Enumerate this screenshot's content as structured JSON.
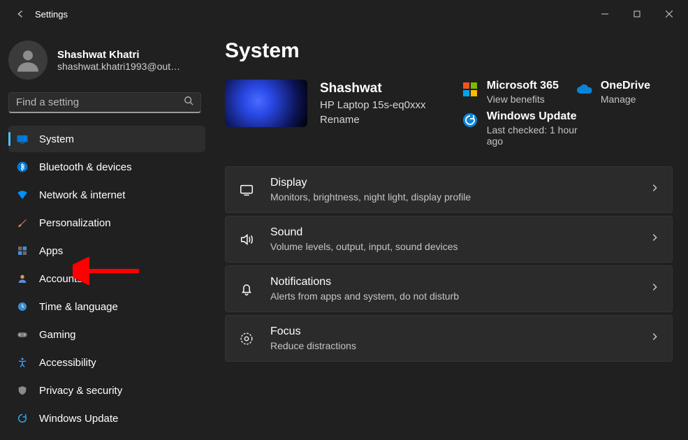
{
  "window": {
    "title": "Settings"
  },
  "account": {
    "name": "Shashwat Khatri",
    "email": "shashwat.khatri1993@out…"
  },
  "search": {
    "placeholder": "Find a setting"
  },
  "nav": {
    "items": [
      {
        "id": "system",
        "label": "System"
      },
      {
        "id": "bluetooth",
        "label": "Bluetooth & devices"
      },
      {
        "id": "network",
        "label": "Network & internet"
      },
      {
        "id": "personalization",
        "label": "Personalization"
      },
      {
        "id": "apps",
        "label": "Apps"
      },
      {
        "id": "accounts",
        "label": "Accounts"
      },
      {
        "id": "time",
        "label": "Time & language"
      },
      {
        "id": "gaming",
        "label": "Gaming"
      },
      {
        "id": "accessibility",
        "label": "Accessibility"
      },
      {
        "id": "privacy",
        "label": "Privacy & security"
      },
      {
        "id": "update",
        "label": "Windows Update"
      }
    ],
    "selected": "system"
  },
  "page": {
    "title": "System"
  },
  "device": {
    "name": "Shashwat",
    "model": "HP Laptop 15s-eq0xxx",
    "rename": "Rename"
  },
  "tiles": {
    "m365": {
      "title": "Microsoft 365",
      "sub": "View benefits"
    },
    "onedrive": {
      "title": "OneDrive",
      "sub": "Manage"
    },
    "update": {
      "title": "Windows Update",
      "sub": "Last checked: 1 hour ago"
    }
  },
  "cards": [
    {
      "id": "display",
      "title": "Display",
      "sub": "Monitors, brightness, night light, display profile"
    },
    {
      "id": "sound",
      "title": "Sound",
      "sub": "Volume levels, output, input, sound devices"
    },
    {
      "id": "notifications",
      "title": "Notifications",
      "sub": "Alerts from apps and system, do not disturb"
    },
    {
      "id": "focus",
      "title": "Focus",
      "sub": "Reduce distractions"
    }
  ]
}
